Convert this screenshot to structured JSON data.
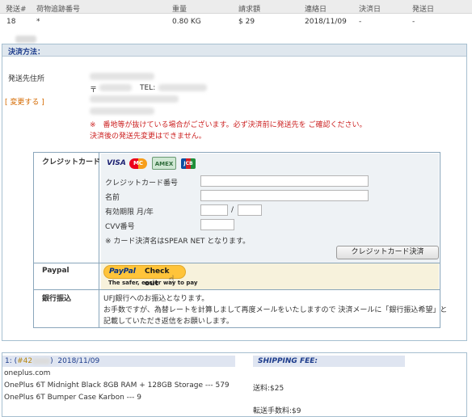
{
  "header": {
    "col_no": "発送#",
    "col_tracking": "荷物追跡番号",
    "col_weight": "重量",
    "col_amount": "請求額",
    "col_contact": "連絡日",
    "col_payment": "決済日",
    "col_ship": "発送日"
  },
  "shipment_row": {
    "no_prefix": "18",
    "tracking": "*",
    "weight": "0.80 KG",
    "amount": "$ 29",
    "contact_date": "2018/11/09",
    "payment_date": "-",
    "ship_date": "-"
  },
  "payment": {
    "title": "決済方法：",
    "address_label": "発送先住所",
    "postal_mark": "〒",
    "tel_label": "TEL:",
    "change_link": "[ 変更する ]",
    "warning_1": "※　番地等が抜けている場合がございます。必ず決済前に発送先を ご確認ください。",
    "warning_2": "決済後の発送先変更はできません。",
    "credit": {
      "label": "クレジットカード",
      "logos": {
        "visa": "VISA",
        "mastercard": "MC",
        "amex": "AMEX",
        "jcb": "JCB"
      },
      "card_number_label": "クレジットカード番号",
      "name_label": "名前",
      "expiry_label": "有効期限 月/年",
      "expiry_sep": "/",
      "cvv_label": "CVV番号",
      "note": "※ カード決済名はSPEAR NET となります。",
      "submit": "クレジットカード決済"
    },
    "paypal": {
      "label": "Paypal",
      "button_brand": "PayPal",
      "button_action": "Check out",
      "tagline": "The safer, easier way to pay"
    },
    "bank": {
      "label": "銀行振込",
      "line_1": "UFJ銀行へのお振込となります。",
      "line_2": "お手数ですが、為替レートを計算しまして再度メールをいたしますので 決済メールに「銀行振込希望」と",
      "line_3": "記載していただき返信をお願いします。"
    }
  },
  "order": {
    "head_prefix": "1: (",
    "head_id": "#42",
    "head_suffix": ")",
    "head_date": "2018/11/09",
    "shop": "oneplus.com",
    "items": [
      "OnePlus 6T Midnight Black 8GB RAM + 128GB Storage --- 579",
      "OnePlus 6T Bumper Case Karbon --- 9"
    ],
    "shipping_title": "SHIPPING FEE:",
    "shipping_fee": "送料:$25",
    "transfer_fee": "転送手数料:$9"
  },
  "colors": {
    "accent_blue": "#1d3c8c",
    "warning_red": "#cc2222",
    "link_orange": "#d46a00",
    "paypal_yellow": "#ffc43a"
  }
}
